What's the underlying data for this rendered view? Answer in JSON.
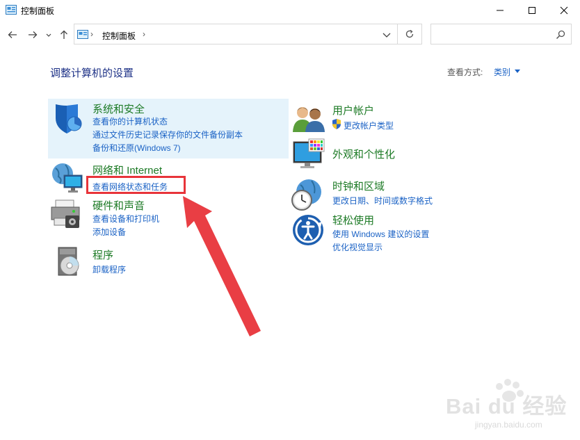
{
  "window": {
    "title": "控制面板"
  },
  "address": {
    "path_label": "控制面板",
    "separator": "›",
    "search_placeholder": ""
  },
  "header": {
    "heading": "调整计算机的设置",
    "view_by_label": "查看方式:",
    "view_by_value": "类别"
  },
  "categories": {
    "system": {
      "title": "系统和安全",
      "links": [
        "查看你的计算机状态",
        "通过文件历史记录保存你的文件备份副本",
        "备份和还原(Windows 7)"
      ]
    },
    "network": {
      "title": "网络和 Internet",
      "links": [
        "查看网络状态和任务"
      ]
    },
    "hardware": {
      "title": "硬件和声音",
      "links": [
        "查看设备和打印机",
        "添加设备"
      ]
    },
    "programs": {
      "title": "程序",
      "links": [
        "卸载程序"
      ]
    },
    "user": {
      "title": "用户帐户",
      "links": [
        "更改帐户类型"
      ]
    },
    "appearance": {
      "title": "外观和个性化",
      "links": []
    },
    "clock": {
      "title": "时钟和区域",
      "links": [
        "更改日期、时间或数字格式"
      ]
    },
    "ease": {
      "title": "轻松使用",
      "links": [
        "使用 Windows 建议的设置",
        "优化视觉显示"
      ]
    }
  },
  "watermark": {
    "brand": "Bai du 经验",
    "url": "jingyan.baidu.com"
  },
  "colors": {
    "category_title": "#1c7a25",
    "link": "#1a62c5",
    "heading": "#1e3287",
    "highlight_bg": "#e5f3fb",
    "annotation_red": "#e8343a"
  }
}
